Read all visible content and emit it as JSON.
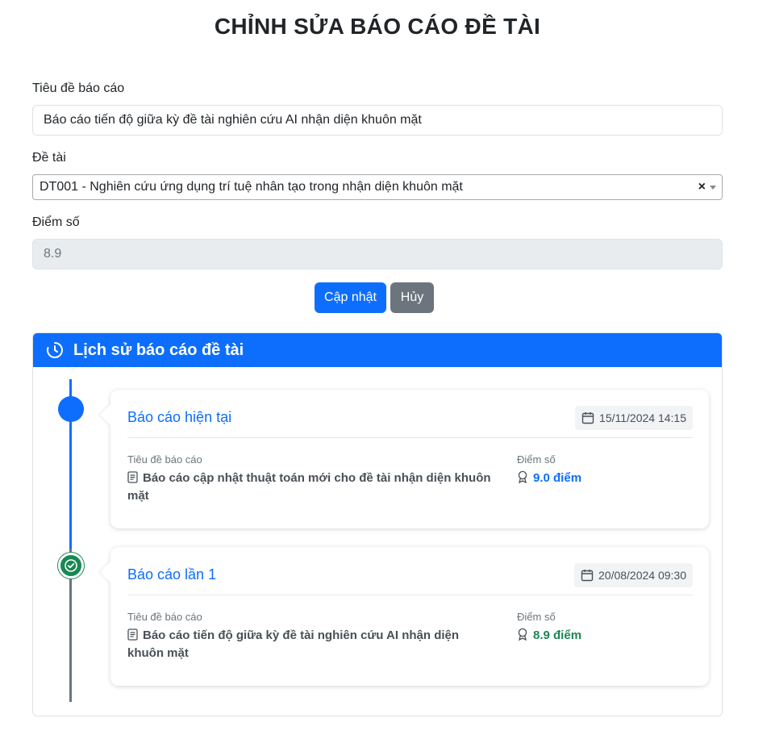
{
  "page_title": "CHỈNH SỬA BÁO CÁO ĐỀ TÀI",
  "form": {
    "title_label": "Tiêu đề báo cáo",
    "title_value": "Báo cáo tiến độ giữa kỳ đề tài nghiên cứu AI nhận diện khuôn mặt",
    "topic_label": "Đề tài",
    "topic_value": "DT001 - Nghiên cứu ứng dụng trí tuệ nhân tạo trong nhận diện khuôn mặt",
    "topic_clear": "×",
    "score_label": "Điểm số",
    "score_value": "8.9",
    "update_button": "Cập nhật",
    "cancel_button": "Hủy"
  },
  "history": {
    "header": "Lịch sử báo cáo đề tài",
    "entries": [
      {
        "title": "Báo cáo hiện tại",
        "date": "15/11/2024 14:15",
        "report_label": "Tiêu đề báo cáo",
        "report_title": "Báo cáo cập nhật thuật toán mới cho đề tài nhận diện khuôn mặt",
        "score_label": "Điểm số",
        "score": "9.0 điểm",
        "score_color": "#0d6efd"
      },
      {
        "title": "Báo cáo lần 1",
        "date": "20/08/2024 09:30",
        "report_label": "Tiêu đề báo cáo",
        "report_title": "Báo cáo tiến độ giữa kỳ đề tài nghiên cứu AI nhận diện khuôn mặt",
        "score_label": "Điểm số",
        "score": "8.9 điểm",
        "score_color": "#198754"
      }
    ]
  },
  "colors": {
    "primary": "#0d6efd",
    "secondary": "#6c757d",
    "success": "#198754",
    "disabled_bg": "#e9ecef"
  },
  "icons": [
    "clock-icon",
    "calendar-icon",
    "document-icon",
    "award-icon",
    "check-icon",
    "clear-icon",
    "dropdown-arrow-icon"
  ]
}
